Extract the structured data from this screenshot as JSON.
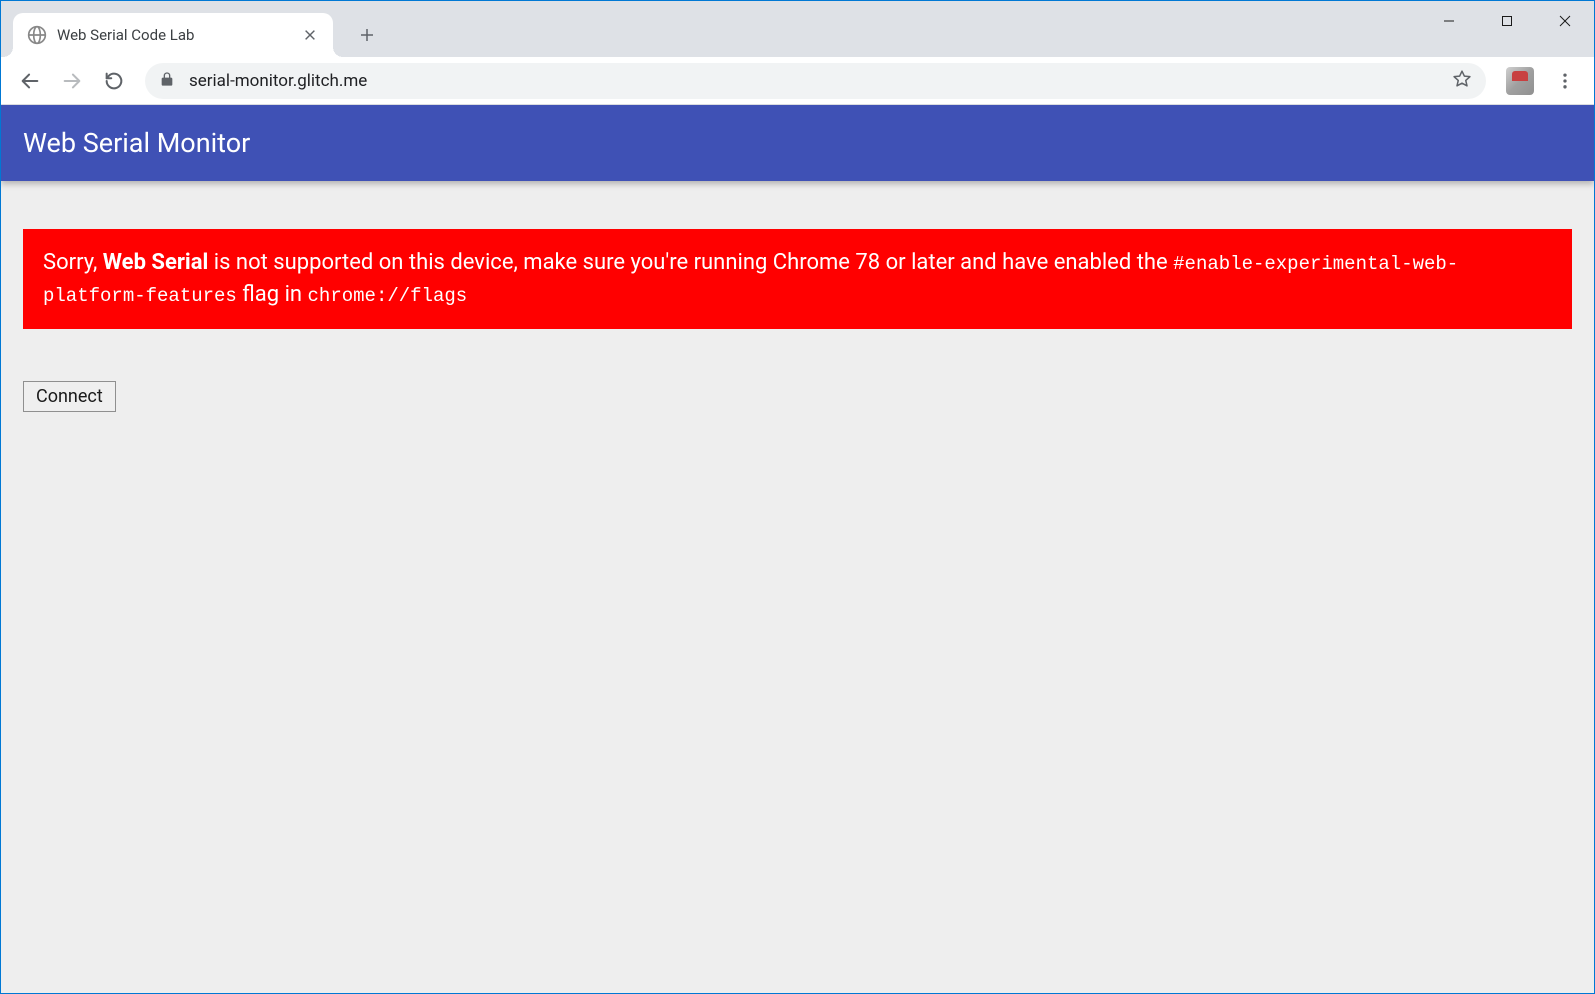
{
  "browser": {
    "tab_title": "Web Serial Code Lab",
    "url": "serial-monitor.glitch.me"
  },
  "page": {
    "header_title": "Web Serial Monitor",
    "error": {
      "prefix": "Sorry, ",
      "bold": "Web Serial",
      "mid1": " is not supported on this device, make sure you're running Chrome 78 or later and have enabled the ",
      "code1": "#enable-experimental-web-platform-features",
      "mid2": " flag in ",
      "code2": "chrome://flags"
    },
    "connect_button": "Connect"
  }
}
